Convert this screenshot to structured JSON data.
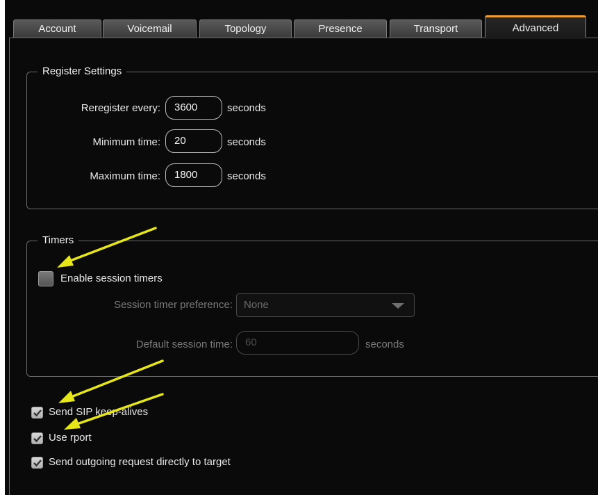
{
  "tabs": [
    {
      "label": "Account"
    },
    {
      "label": "Voicemail"
    },
    {
      "label": "Topology"
    },
    {
      "label": "Presence"
    },
    {
      "label": "Transport"
    },
    {
      "label": "Advanced",
      "active": true
    }
  ],
  "register": {
    "legend": "Register Settings",
    "reregister_label": "Reregister every:",
    "reregister_value": "3600",
    "min_label": "Minimum time:",
    "min_value": "20",
    "max_label": "Maximum time:",
    "max_value": "1800",
    "unit": "seconds"
  },
  "timers": {
    "legend": "Timers",
    "enable_label": "Enable session timers",
    "enable_checked": false,
    "preference_label": "Session timer preference:",
    "preference_value": "None",
    "default_label": "Default session time:",
    "default_value": "60",
    "unit": "seconds"
  },
  "options": {
    "keepalive_label": "Send SIP keep-alives",
    "keepalive_checked": true,
    "rport_label": "Use rport",
    "rport_checked": true,
    "direct_label": "Send outgoing request directly to target",
    "direct_checked": true
  },
  "colors": {
    "panel_bg": "#0a0a0a",
    "tab_accent": "#f0a030",
    "annotation_arrow": "#e6e619"
  }
}
